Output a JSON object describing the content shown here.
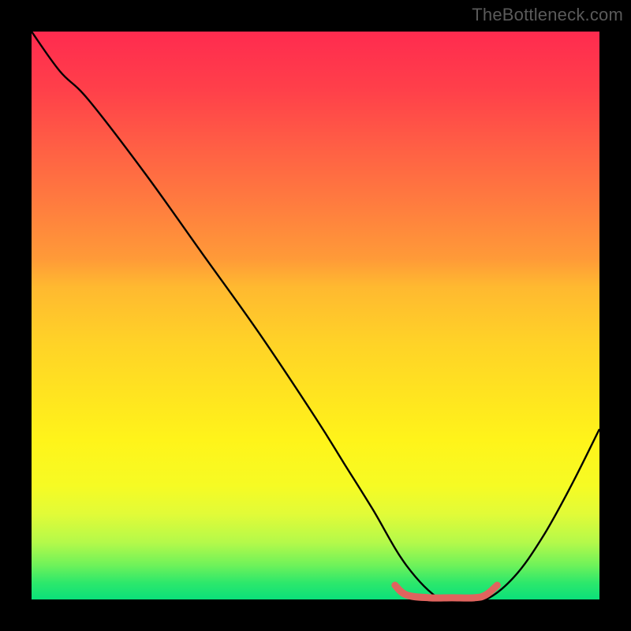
{
  "watermark": "TheBottleneck.com",
  "chart_data": {
    "type": "line",
    "title": "",
    "xlabel": "",
    "ylabel": "",
    "xlim": [
      0,
      100
    ],
    "ylim": [
      0,
      100
    ],
    "series": [
      {
        "name": "bottleneck-curve",
        "x": [
          0,
          5,
          10,
          20,
          30,
          40,
          50,
          55,
          60,
          66,
          72,
          76,
          80,
          85,
          90,
          95,
          100
        ],
        "y": [
          100,
          93,
          88,
          75,
          61,
          47,
          32,
          24,
          16,
          6,
          0,
          0,
          0,
          4,
          11,
          20,
          30
        ]
      },
      {
        "name": "optimal-range-marker",
        "x": [
          64,
          66,
          70,
          74,
          78,
          80,
          82
        ],
        "y": [
          2.5,
          0.8,
          0.3,
          0.3,
          0.3,
          0.8,
          2.5
        ]
      }
    ],
    "gradient_stops": [
      {
        "pos": 0.0,
        "color": "#ff2b4f"
      },
      {
        "pos": 0.5,
        "color": "#ffc728"
      },
      {
        "pos": 0.8,
        "color": "#f4fa22"
      },
      {
        "pos": 1.0,
        "color": "#0be07a"
      }
    ],
    "colors": {
      "curve": "#000000",
      "marker": "#e0645e",
      "background": "#000000"
    }
  }
}
